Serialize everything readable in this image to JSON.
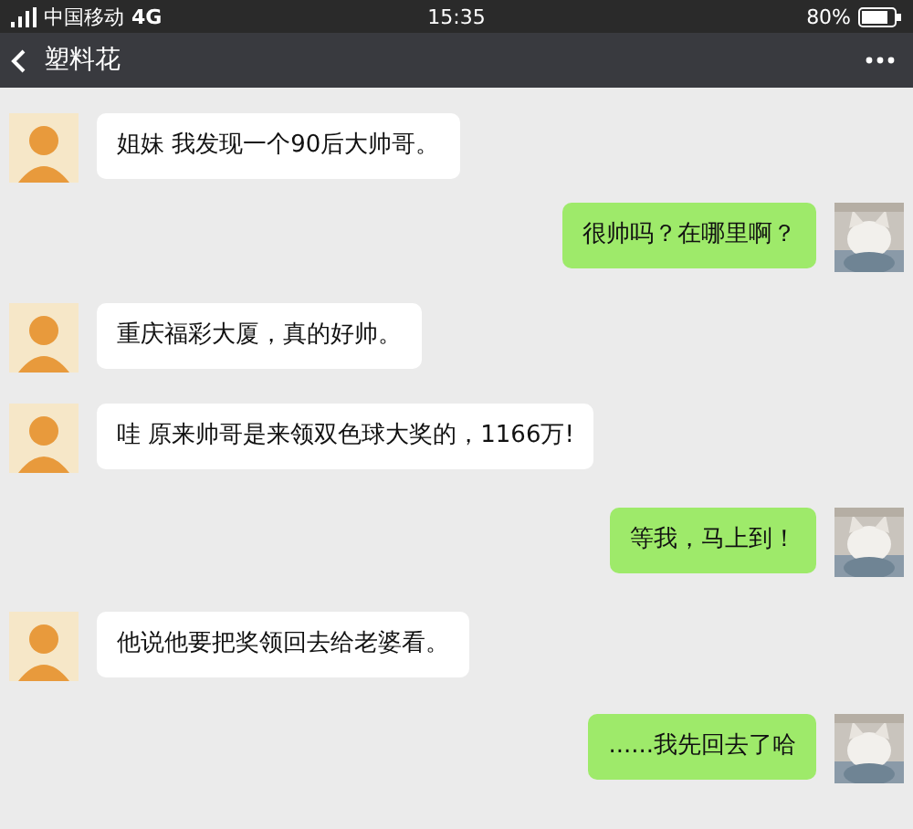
{
  "status_bar": {
    "carrier": "中国移动",
    "network": "4G",
    "time": "15:35",
    "battery": "80%"
  },
  "header": {
    "title": "塑料花"
  },
  "messages": [
    {
      "kind": "received",
      "text": "姐妹 我发现一个90后大帅哥。"
    },
    {
      "kind": "sent",
      "text": "很帅吗？在哪里啊？"
    },
    {
      "kind": "received",
      "text": "重庆福彩大厦，真的好帅。"
    },
    {
      "kind": "received",
      "text": "哇 原来帅哥是来领双色球大奖的，1166万!"
    },
    {
      "kind": "sent",
      "text": "等我，马上到！"
    },
    {
      "kind": "received",
      "text": "他说他要把奖领回去给老婆看。"
    },
    {
      "kind": "sent",
      "text": "......我先回去了哈"
    }
  ]
}
